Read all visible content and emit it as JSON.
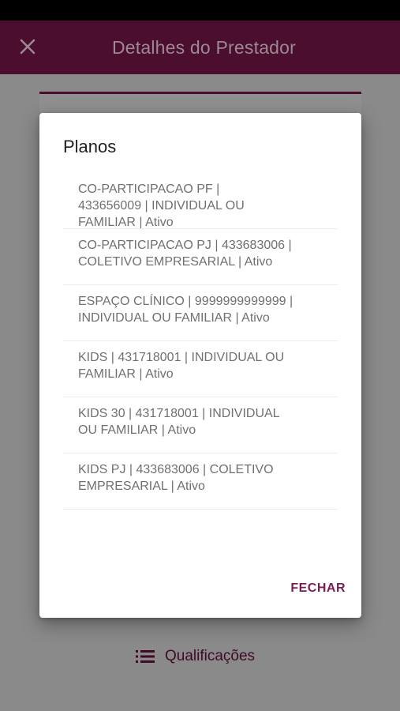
{
  "app_bar": {
    "title": "Detalhes do Prestador",
    "close_icon": "close-icon",
    "background": "#4b0e2e"
  },
  "background_page": {
    "qualificacoes_label": "Qualificações",
    "qualificacoes_icon": "list-icon"
  },
  "dialog": {
    "title": "Planos",
    "plans": [
      "CO-PARTICIPACAO PF             |\n433656009 | INDIVIDUAL OU\nFAMILIAR | Ativo",
      "CO-PARTICIPACAO PJ | 433683006 |\nCOLETIVO EMPRESARIAL | Ativo",
      "ESPAÇO CLÍNICO | 9999999999999 |\nINDIVIDUAL OU FAMILIAR | Ativo",
      "KIDS | 431718001 | INDIVIDUAL OU\nFAMILIAR | Ativo",
      "KIDS 30 | 431718001 | INDIVIDUAL\nOU FAMILIAR | Ativo",
      "KIDS PJ | 433683006 | COLETIVO\nEMPRESARIAL | Ativo"
    ],
    "close_label": "FECHAR",
    "accent": "#7a1d54"
  }
}
